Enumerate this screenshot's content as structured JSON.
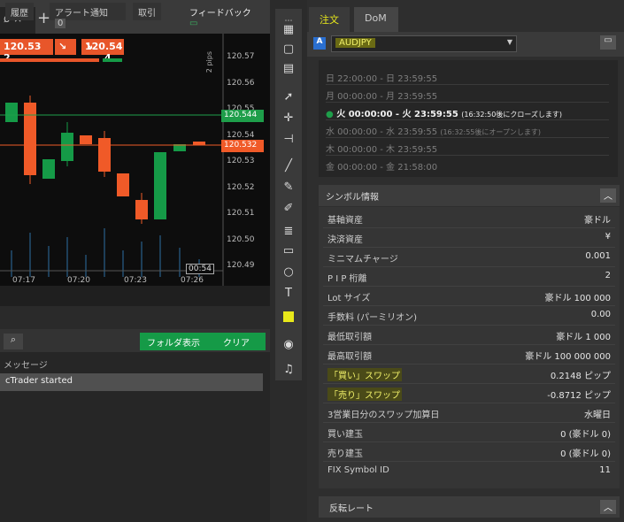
{
  "chart_tabs": {
    "tab1": "ø ×",
    "plus": "+"
  },
  "trade": {
    "sell": "120.53 2",
    "sell_icon": "↘",
    "buy": "120.54 4",
    "buy_icon": "↘"
  },
  "price_axis": {
    "labels": [
      "120.57",
      "120.56",
      "120.55",
      "120.54",
      "120.53",
      "120.52",
      "120.51",
      "120.50",
      "120.49"
    ],
    "ask": "120.544",
    "bid": "120.532",
    "pips": "2 pips"
  },
  "time_axis": [
    "07:17",
    "07:20",
    "07:23",
    "07:26"
  ],
  "countdown": "00:54",
  "bottom_tabs": {
    "history": "履歴",
    "alerts": "アラート通知",
    "alerts_count": "0",
    "trade": "取引",
    "feedback": "フィードバック"
  },
  "log": {
    "folder_btn": "フォルダ表示",
    "clear_btn": "クリア",
    "header": "メッセージ",
    "row1": "cTrader started"
  },
  "right_tabs": {
    "order": "注文",
    "dom": "DoM"
  },
  "symbol": {
    "badge": "A",
    "name": "AUDJPY"
  },
  "schedule": [
    {
      "text": "日 22:00:00 - 日 23:59:55",
      "note": ""
    },
    {
      "text": "月 00:00:00 - 月 23:59:55",
      "note": ""
    },
    {
      "text": "火 00:00:00 - 火 23:59:55",
      "note": "(16:32:50後にクローズします)"
    },
    {
      "text": "水 00:00:00 - 水 23:59:55",
      "note": "(16:32:55後にオープンします)"
    },
    {
      "text": "木 00:00:00 - 木 23:59:55",
      "note": ""
    },
    {
      "text": "金 00:00:00 - 金 21:58:00",
      "note": ""
    }
  ],
  "symbol_info": {
    "title": "シンボル情報",
    "rows": [
      {
        "k": "基軸資産",
        "v": "豪ドル"
      },
      {
        "k": "決済資産",
        "v": "¥"
      },
      {
        "k": "ミニマムチャージ",
        "v": "0.001"
      },
      {
        "k": "P I P 桁離",
        "v": "2"
      },
      {
        "k": "Lot サイズ",
        "v": "豪ドル 100 000"
      },
      {
        "k": "手数料 (パーミリオン)",
        "v": "0.00"
      },
      {
        "k": "最低取引額",
        "v": "豪ドル 1 000"
      },
      {
        "k": "最高取引額",
        "v": "豪ドル 100 000 000"
      },
      {
        "k": "「買い」スワップ",
        "v": "0.2148 ピップ"
      },
      {
        "k": "「売り」スワップ",
        "v": "-0.8712 ピップ"
      },
      {
        "k": "3営業日分のスワップ加算日",
        "v": "水曜日"
      },
      {
        "k": "買い建玉",
        "v": "0 (豪ドル 0)"
      },
      {
        "k": "売り建玉",
        "v": "0 (豪ドル 0)"
      },
      {
        "k": "FIX Symbol ID",
        "v": "11"
      }
    ]
  },
  "reverse_rate": {
    "title": "反転レート"
  },
  "colors": {
    "bull": "#159a47",
    "bear": "#f05a28",
    "highlight": "#d8d82a",
    "ask_line": "#1e9e4a",
    "bid_line": "#f05a28"
  }
}
